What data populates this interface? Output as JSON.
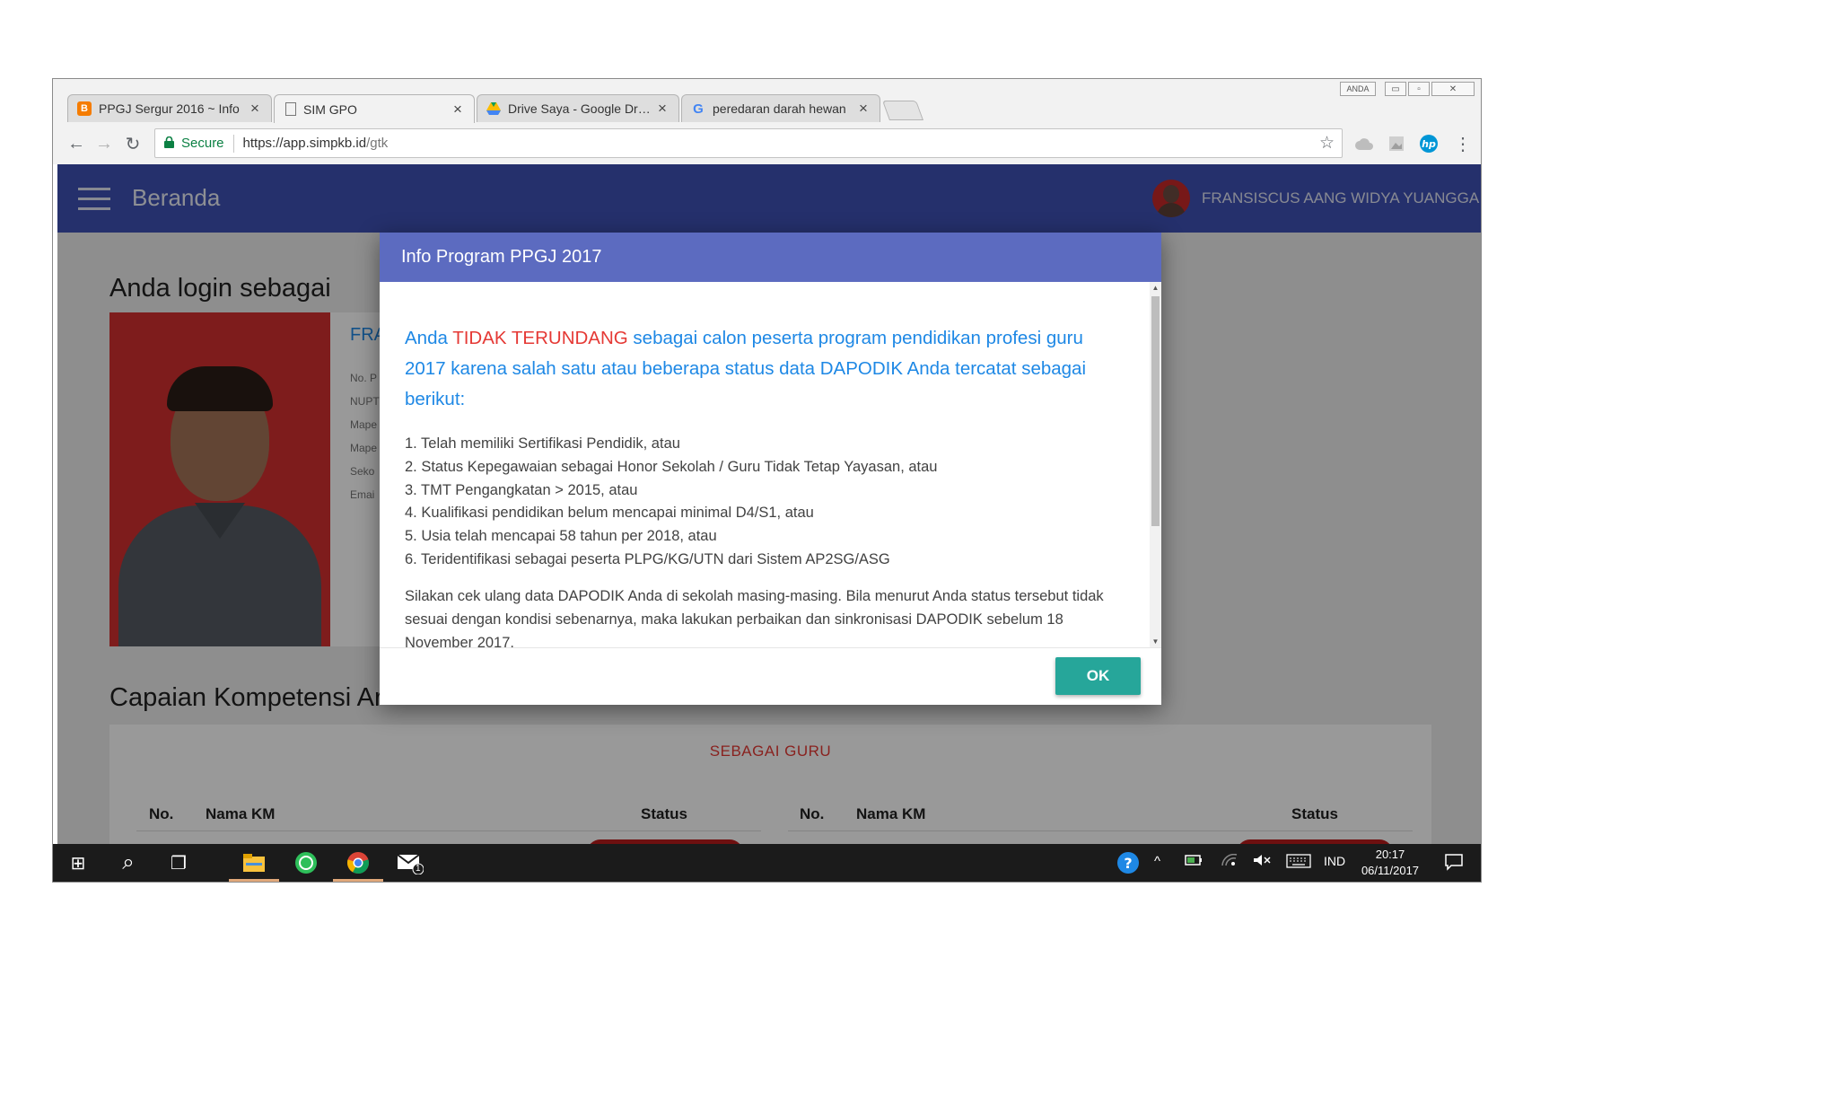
{
  "window": {
    "controls": {
      "user_badge": "ANDA",
      "minimize": "▭",
      "maximize": "▫",
      "close": "✕"
    }
  },
  "tabs": [
    {
      "label": "PPGJ Sergur 2016 ~ Info",
      "icon": "blogger-icon",
      "close": "×"
    },
    {
      "label": "SIM GPO",
      "icon": "page-icon",
      "close": "×"
    },
    {
      "label": "Drive Saya - Google Drive",
      "icon": "google-drive-icon",
      "close": "×"
    },
    {
      "label": "peredaran darah hewan",
      "icon": "google-icon",
      "close": "×"
    }
  ],
  "toolbar": {
    "back": "←",
    "forward": "→",
    "reload": "↻",
    "secure_label": "Secure",
    "url_host": "https://app.simpkb.id",
    "url_path": "/gtk",
    "star": "☆",
    "menu": "⋮"
  },
  "app": {
    "title": "Beranda",
    "user_name": "FRANSISCUS AANG WIDYA YUANGGA",
    "login_heading": "Anda login sebagai",
    "profile_name_partial": "FRA",
    "profile_fields": [
      "No. P",
      "NUPT",
      "Mape",
      "Mape",
      "Seko",
      "Emai"
    ],
    "capaian_heading": "Capaian Kompetensi Ar",
    "table_section_title": "SEBAGAI GURU",
    "table_headers": {
      "left": [
        "No.",
        "Nama KM",
        "Status"
      ],
      "right": [
        "No.",
        "Nama KM",
        "Status"
      ]
    }
  },
  "dialog": {
    "title": "Info Program PPGJ 2017",
    "lead_before": "Anda ",
    "lead_highlight": "TIDAK TERUNDANG",
    "lead_after": " sebagai calon peserta program pendidikan profesi guru 2017 karena salah satu atau beberapa status data DAPODIK Anda tercatat sebagai berikut:",
    "reasons": [
      "1. Telah memiliki Sertifikasi Pendidik, atau",
      "2. Status Kepegawaian sebagai Honor Sekolah / Guru Tidak Tetap Yayasan, atau",
      "3. TMT Pengangkatan > 2015, atau",
      "4. Kualifikasi pendidikan belum mencapai minimal D4/S1, atau",
      "5. Usia telah mencapai 58 tahun per 2018, atau",
      "6. Teridentifikasi sebagai peserta PLPG/KG/UTN dari Sistem AP2SG/ASG"
    ],
    "note": "Silakan cek ulang data DAPODIK Anda di sekolah masing-masing. Bila menurut Anda status tersebut tidak sesuai dengan kondisi sebenarnya, maka lakukan perbaikan dan sinkronisasi DAPODIK sebelum 18 November 2017.",
    "ok_label": "OK"
  },
  "taskbar": {
    "start": "⊞",
    "search": "⌕",
    "task_view": "❐",
    "tray_lang": "IND",
    "clock_time": "20:17",
    "clock_date": "06/11/2017",
    "mail_badge": "1"
  },
  "colors": {
    "appbar": "#3f51b5",
    "dialog_header": "#5c6bc0",
    "lead_text": "#1e88e5",
    "highlight": "#e53935",
    "ok_button": "#26a69a"
  }
}
